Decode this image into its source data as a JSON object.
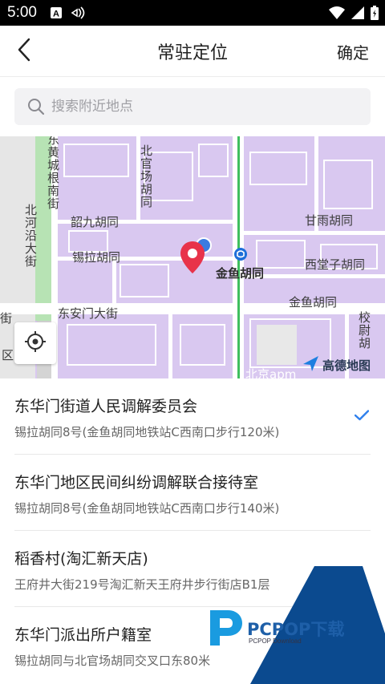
{
  "status_bar": {
    "time": "5:00",
    "icons": [
      "a-icon",
      "signal-icon",
      "wifi-icon",
      "cellular-icon",
      "battery-icon"
    ]
  },
  "title_bar": {
    "title": "常驻定位",
    "confirm_label": "确定"
  },
  "search": {
    "placeholder": "搜索附近地点"
  },
  "map": {
    "labels": {
      "donghuangchenggen": "东黄城根南街",
      "beiguanchang": "北官场胡同",
      "beiheyan": "北河沿大街",
      "shaojiu": "韶九胡同",
      "xila": "锡拉胡同",
      "jinyu_station": "金鱼胡同",
      "ganyu": "甘雨胡同",
      "xitangzi": "西堂子胡同",
      "donganmen": "东安门大街",
      "jinyu_st": "金鱼胡同",
      "xiaowei": "校尉胡",
      "beijing_apm": "北京apm",
      "jie": "街",
      "qu": "区"
    },
    "provider": "高德地图",
    "colors": {
      "block": "#d9c8f0",
      "road": "#ffffff",
      "subway": "#3fbf5f",
      "pin": "#e8334a"
    }
  },
  "places": [
    {
      "name": "东华门街道人民调解委员会",
      "address": "锡拉胡同8号(金鱼胡同地铁站C西南口步行120米)",
      "selected": true
    },
    {
      "name": "东华门地区民间纠纷调解联合接待室",
      "address": "锡拉胡同8号(金鱼胡同地铁站C西南口步行140米)",
      "selected": false
    },
    {
      "name": "稻香村(淘汇新天店)",
      "address": "王府井大街219号淘汇新天王府井步行街店B1层",
      "selected": false
    },
    {
      "name": "东华门派出所户籍室",
      "address": "锡拉胡同与北官场胡同交叉口东80米",
      "selected": false
    }
  ],
  "watermark": {
    "brand": "PCPOP下载",
    "sub": "PCPOP Download",
    "accent": "#0b4a8f"
  }
}
